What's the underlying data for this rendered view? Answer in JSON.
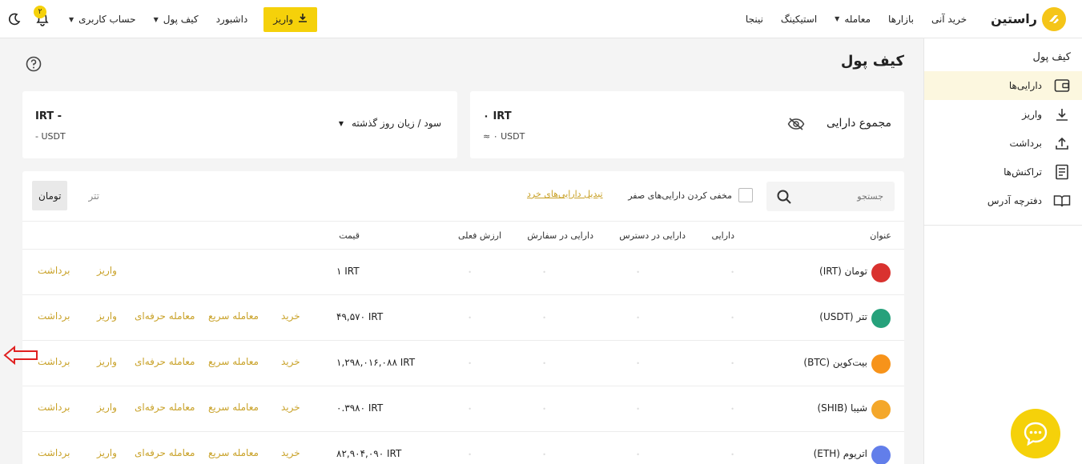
{
  "header": {
    "logo_text": "راستین",
    "nav": [
      {
        "label": "خرید آنی"
      },
      {
        "label": "بازارها"
      },
      {
        "label": "معامله",
        "caret": true
      },
      {
        "label": "استیکینگ"
      },
      {
        "label": "نینجا"
      }
    ],
    "deposit_label": "واریز",
    "right_nav": [
      {
        "label": "داشبورد"
      },
      {
        "label": "کیف پول",
        "caret": true
      },
      {
        "label": "حساب کاربری",
        "caret": true
      }
    ],
    "notification_count": "۲",
    "icons": {
      "bell": "bell-icon",
      "theme": "moon-icon",
      "deposit": "download-icon"
    }
  },
  "sidebar": {
    "title": "کیف پول",
    "items": [
      {
        "label": "دارایی‌ها",
        "icon": "wallet-icon",
        "active": true
      },
      {
        "label": "واریز",
        "icon": "download-icon"
      },
      {
        "label": "برداشت",
        "icon": "upload-icon"
      },
      {
        "label": "تراکنش‌ها",
        "icon": "receipt-icon"
      },
      {
        "label": "دفترچه آدرس",
        "icon": "book-icon"
      }
    ]
  },
  "main": {
    "title": "کیف پول",
    "summary": {
      "title": "مجموع دارایی",
      "irt": "۰ IRT",
      "usdt": "≈ ۰ USDT"
    },
    "pnl": {
      "label": "سود / زیان روز گذشته",
      "irt": "IRT -",
      "usdt": "- USDT"
    },
    "search_placeholder": "جستجو",
    "hide_zero_label": "مخفی کردن دارایی‌های صفر",
    "convert_link": "تبدیل دارایی‌های خرد",
    "toggles": {
      "toman": "تومان",
      "tether": "تتر"
    },
    "columns": {
      "title": "عنوان",
      "balance": "دارایی",
      "available": "دارایی در دسترس",
      "in_order": "دارایی در سفارش",
      "value": "ارزش فعلی",
      "price": "قیمت"
    },
    "actions": {
      "withdraw": "برداشت",
      "deposit": "واریز",
      "pro_trade": "معامله حرفه‌ای",
      "quick_trade": "معامله سریع",
      "buy": "خرید"
    },
    "rows": [
      {
        "name": "تومان (IRT)",
        "price": "۱ IRT",
        "icon_color": "#d9322f",
        "full": false
      },
      {
        "name": "تتر (USDT)",
        "price": "۴۹,۵۷۰ IRT",
        "icon_color": "#26a17b",
        "full": true
      },
      {
        "name": "بیت‌کوین (BTC)",
        "price": "۱,۲۹۸,۰۱۶,۰۸۸ IRT",
        "icon_color": "#f7931a",
        "full": true
      },
      {
        "name": "شیبا (SHIB)",
        "price": "۰.۳۹۸۰ IRT",
        "icon_color": "#f4a72a",
        "full": true
      },
      {
        "name": "اتریوم (ETH)",
        "price": "۸۲,۹۰۴,۰۹۰ IRT",
        "icon_color": "#627eea",
        "full": true
      }
    ]
  }
}
